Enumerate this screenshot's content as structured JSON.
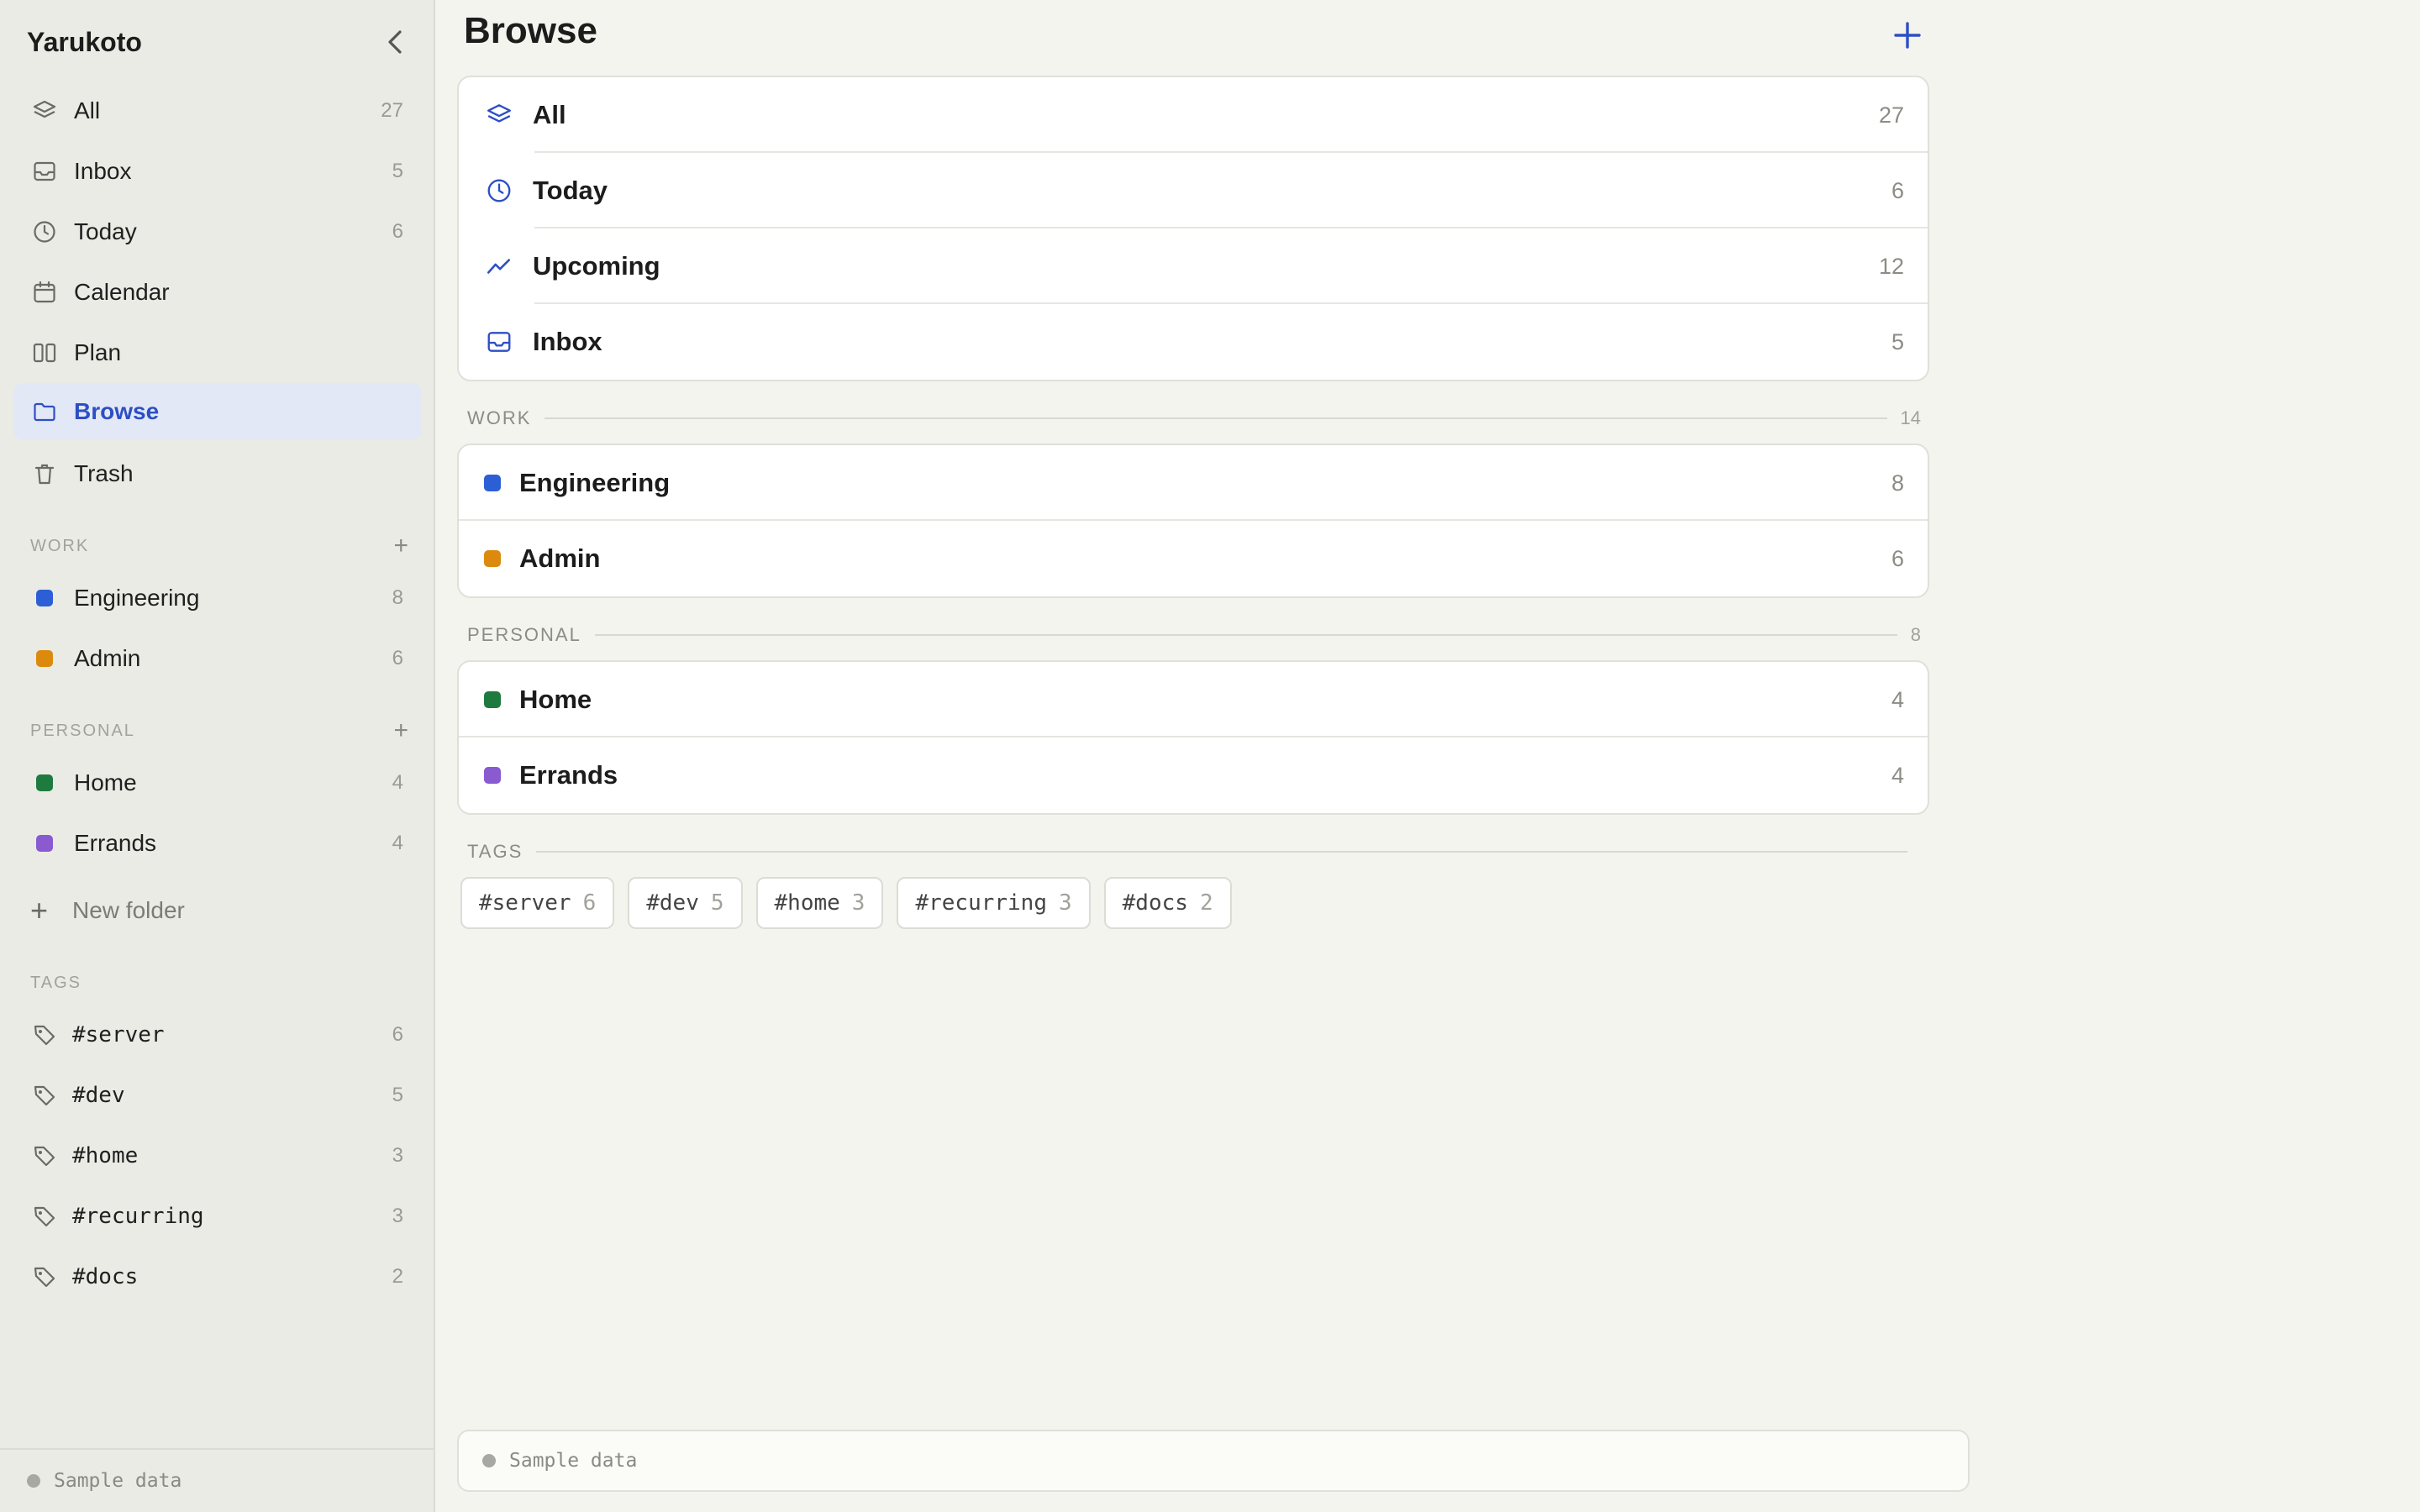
{
  "app": {
    "name": "Yarukoto"
  },
  "sidebar": {
    "nav": [
      {
        "label": "All",
        "count": "27",
        "icon": "layers-icon"
      },
      {
        "label": "Inbox",
        "count": "5",
        "icon": "inbox-icon"
      },
      {
        "label": "Today",
        "count": "6",
        "icon": "clock-icon"
      },
      {
        "label": "Calendar",
        "count": "",
        "icon": "calendar-icon"
      },
      {
        "label": "Plan",
        "count": "",
        "icon": "columns-icon"
      },
      {
        "label": "Browse",
        "count": "",
        "icon": "folder-icon",
        "active": true
      },
      {
        "label": "Trash",
        "count": "",
        "icon": "trash-icon"
      }
    ],
    "work": {
      "title": "WORK",
      "items": [
        {
          "label": "Engineering",
          "count": "8",
          "color": "#2c5fd6"
        },
        {
          "label": "Admin",
          "count": "6",
          "color": "#dc8a0e"
        }
      ]
    },
    "personal": {
      "title": "PERSONAL",
      "items": [
        {
          "label": "Home",
          "count": "4",
          "color": "#1f7a3f"
        },
        {
          "label": "Errands",
          "count": "4",
          "color": "#8a5ad0"
        }
      ]
    },
    "new_folder": "New folder",
    "tags": {
      "title": "TAGS",
      "items": [
        {
          "label": "#server",
          "count": "6"
        },
        {
          "label": "#dev",
          "count": "5"
        },
        {
          "label": "#home",
          "count": "3"
        },
        {
          "label": "#recurring",
          "count": "3"
        },
        {
          "label": "#docs",
          "count": "2"
        }
      ]
    },
    "footer": "Sample data"
  },
  "main": {
    "title": "Browse",
    "smart": [
      {
        "label": "All",
        "count": "27",
        "icon": "layers-icon"
      },
      {
        "label": "Today",
        "count": "6",
        "icon": "clock-icon"
      },
      {
        "label": "Upcoming",
        "count": "12",
        "icon": "trend-icon"
      },
      {
        "label": "Inbox",
        "count": "5",
        "icon": "inbox-icon"
      }
    ],
    "work": {
      "title": "WORK",
      "count": "14",
      "items": [
        {
          "label": "Engineering",
          "count": "8",
          "color": "#2c5fd6"
        },
        {
          "label": "Admin",
          "count": "6",
          "color": "#dc8a0e"
        }
      ]
    },
    "personal": {
      "title": "PERSONAL",
      "count": "8",
      "items": [
        {
          "label": "Home",
          "count": "4",
          "color": "#1f7a3f"
        },
        {
          "label": "Errands",
          "count": "4",
          "color": "#8a5ad0"
        }
      ]
    },
    "tags": {
      "title": "TAGS",
      "items": [
        {
          "label": "#server",
          "count": "6"
        },
        {
          "label": "#dev",
          "count": "5"
        },
        {
          "label": "#home",
          "count": "3"
        },
        {
          "label": "#recurring",
          "count": "3"
        },
        {
          "label": "#docs",
          "count": "2"
        }
      ]
    },
    "footer": "Sample data"
  },
  "colors": {
    "accent": "#2d4fc4",
    "active_bg": "#e2e8f6"
  }
}
